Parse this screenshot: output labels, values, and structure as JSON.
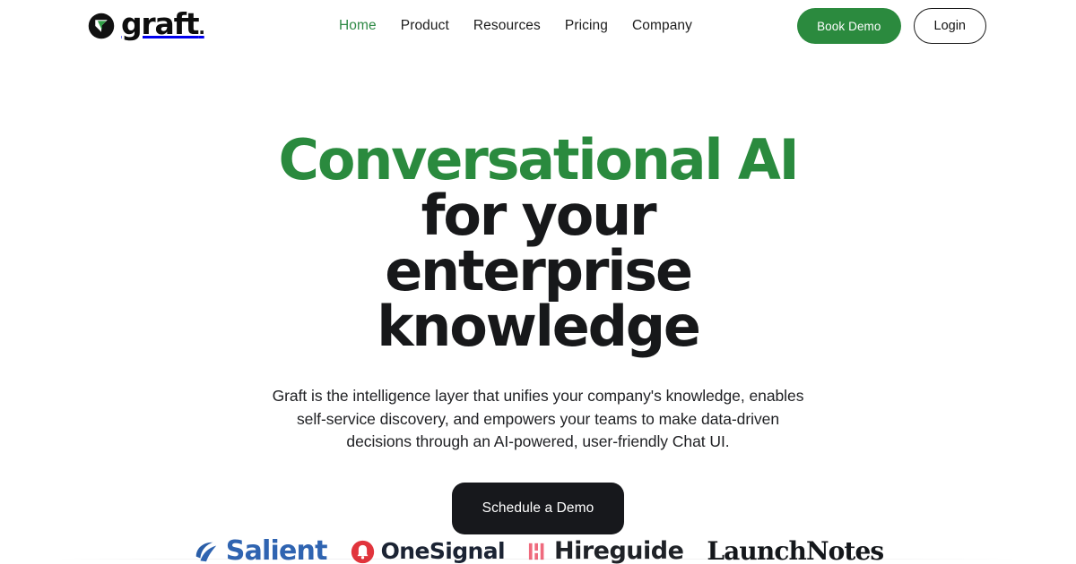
{
  "brand": {
    "name": "graft",
    "trailing_dot": ".",
    "logo_icon": "graft-circle-triangle-logo",
    "logo_circle_color": "#111111",
    "logo_triangle_color": "#2f9e44"
  },
  "nav": {
    "items": [
      {
        "label": "Home",
        "active": true
      },
      {
        "label": "Product",
        "active": false
      },
      {
        "label": "Resources",
        "active": false
      },
      {
        "label": "Pricing",
        "active": false
      },
      {
        "label": "Company",
        "active": false
      }
    ],
    "active_color": "#2f8a46",
    "inactive_color": "#1c1c1c"
  },
  "header_actions": {
    "book_demo_label": "Book Demo",
    "book_demo_bg": "#2b8a3e",
    "login_label": "Login"
  },
  "hero": {
    "headline_accent": "Conversational AI",
    "headline_rest": " for your enterprise knowledge",
    "accent_color": "#2a8a3e",
    "headline_color": "#17181a",
    "subhead": "Graft is the intelligence layer that unifies your company's knowledge, enables self-service discovery, and empowers your teams to make data-driven decisions through an AI-powered, user-friendly Chat UI.",
    "cta_label": "Schedule a Demo",
    "cta_bg": "#17181c"
  },
  "logo_strip": {
    "logos": [
      {
        "name": "Salient",
        "icon": "salient-swoosh-icon",
        "text_color": "#2f64b1",
        "icon_color": "#2a5ea8"
      },
      {
        "name": "OneSignal",
        "icon": "onesignal-bell-circle-icon",
        "text_color": "#1b2333",
        "icon_color": "#e1343c"
      },
      {
        "name": "Hireguide",
        "icon": "hireguide-bars-icon",
        "text_color": "#1f2227",
        "icon_color": "#ef6a7d"
      },
      {
        "name": "LaunchNotes",
        "icon": "none",
        "text_color": "#14171b",
        "icon_color": "#14171b"
      }
    ]
  }
}
